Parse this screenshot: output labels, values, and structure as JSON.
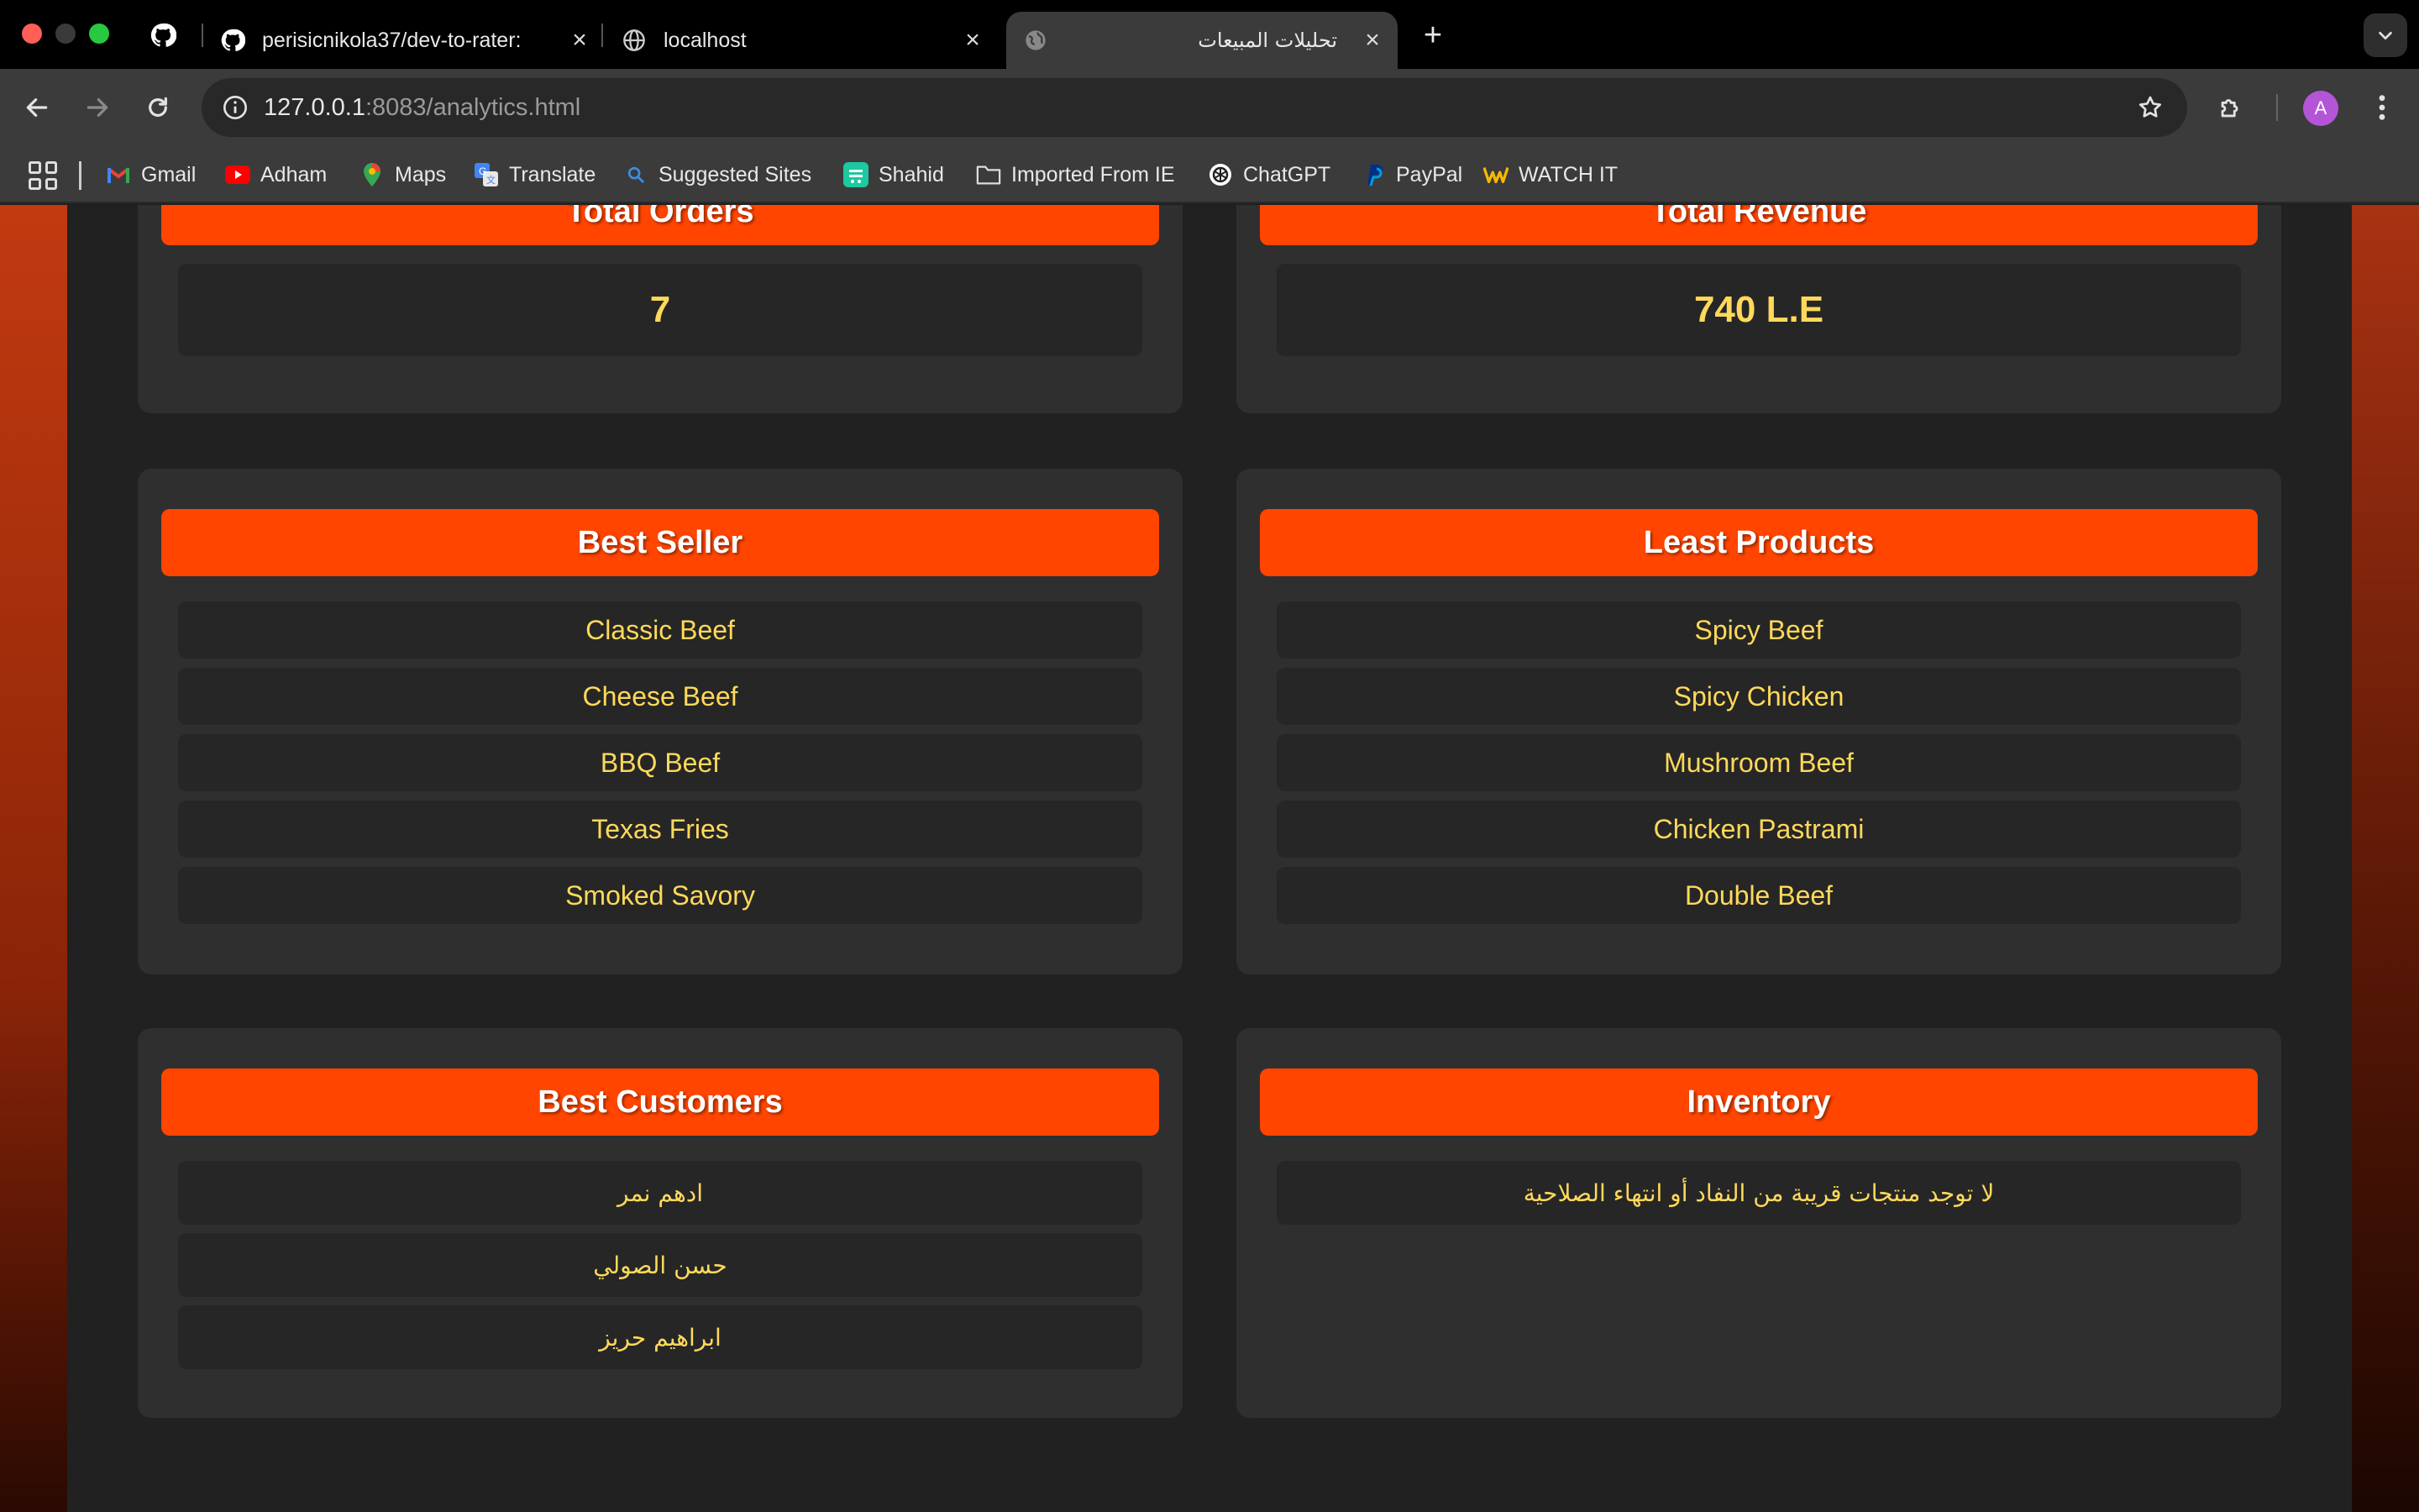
{
  "browser": {
    "tabs": [
      {
        "title": "perisicnikola37/dev-to-rater: ",
        "icon": "github-icon",
        "active": false
      },
      {
        "title": "localhost",
        "icon": "globe-icon",
        "active": false
      },
      {
        "title": "تحليلات المبيعات",
        "icon": "globe-icon",
        "active": true
      }
    ],
    "url_host": "127.0.0.1",
    "url_rest": ":8083/analytics.html",
    "avatar_letter": "A",
    "bookmarks": [
      {
        "label": "Gmail",
        "icon": "gmail-icon"
      },
      {
        "label": "Adham",
        "icon": "youtube-icon"
      },
      {
        "label": "Maps",
        "icon": "maps-icon"
      },
      {
        "label": "Translate",
        "icon": "translate-icon"
      },
      {
        "label": "Suggested Sites",
        "icon": "search-icon"
      },
      {
        "label": "Shahid",
        "icon": "shahid-icon"
      },
      {
        "label": "Imported From IE",
        "icon": "folder-icon"
      },
      {
        "label": "ChatGPT",
        "icon": "chatgpt-icon"
      },
      {
        "label": "PayPal",
        "icon": "paypal-icon"
      },
      {
        "label": "WATCH IT",
        "icon": "watchit-icon"
      }
    ]
  },
  "colors": {
    "accent": "#ff4500",
    "value_text": "#ffd95a",
    "card_bg": "#2f2f2f",
    "row_bg": "#262626"
  },
  "dashboard": {
    "total_orders": {
      "title": "Total Orders",
      "value": "7"
    },
    "total_revenue": {
      "title": "Total Revenue",
      "value": "740 L.E"
    },
    "best_seller": {
      "title": "Best Seller",
      "items": [
        "Classic Beef",
        "Cheese Beef",
        "BBQ Beef",
        "Texas Fries",
        "Smoked Savory"
      ]
    },
    "least_products": {
      "title": "Least Products",
      "items": [
        "Spicy Beef",
        "Spicy Chicken",
        "Mushroom Beef",
        "Chicken Pastrami",
        "Double Beef"
      ]
    },
    "best_customers": {
      "title": "Best Customers",
      "items": [
        "ادهم نمر",
        "حسن الصولي",
        "ابراهيم حريز"
      ]
    },
    "inventory": {
      "title": "Inventory",
      "message": "لا توجد منتجات قريبة من النفاد أو انتهاء الصلاحية"
    }
  }
}
